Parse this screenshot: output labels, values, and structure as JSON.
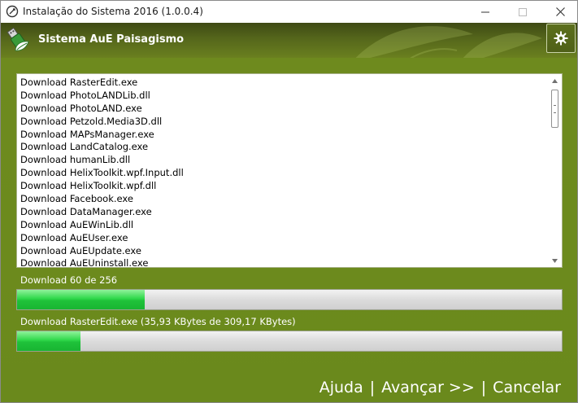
{
  "window": {
    "title": "Instalação do Sistema 2016 (1.0.0.4)",
    "controls": {
      "minimize": "—",
      "maximize": "☐",
      "close": "✕"
    }
  },
  "header": {
    "title": "Sistema AuE Paisagismo",
    "settings_icon": "gear-icon",
    "logo_icon": "usb-leaf-icon"
  },
  "downloads": [
    "Download RasterEdit.exe",
    "Download PhotoLANDLib.dll",
    "Download PhotoLAND.exe",
    "Download Petzold.Media3D.dll",
    "Download MAPsManager.exe",
    "Download LandCatalog.exe",
    "Download humanLib.dll",
    "Download HelixToolkit.wpf.Input.dll",
    "Download HelixToolkit.wpf.dll",
    "Download Facebook.exe",
    "Download DataManager.exe",
    "Download AuEWinLib.dll",
    "Download AuEUser.exe",
    "Download AuEUpdate.exe",
    "Download AuEUninstall.exe"
  ],
  "overall": {
    "text": "Download 60 de 256",
    "progress_fraction": 0.234
  },
  "current": {
    "text": "Download RasterEdit.exe (35,93 KBytes de 309,17 KBytes)",
    "progress_fraction": 0.116
  },
  "footer": {
    "help": "Ajuda",
    "next": "Avançar >>",
    "cancel": "Cancelar",
    "separator": "|"
  },
  "colors": {
    "background_green": "#6c8a1d",
    "progress_fill": "#2fd84a",
    "text_white": "#ffffff"
  }
}
